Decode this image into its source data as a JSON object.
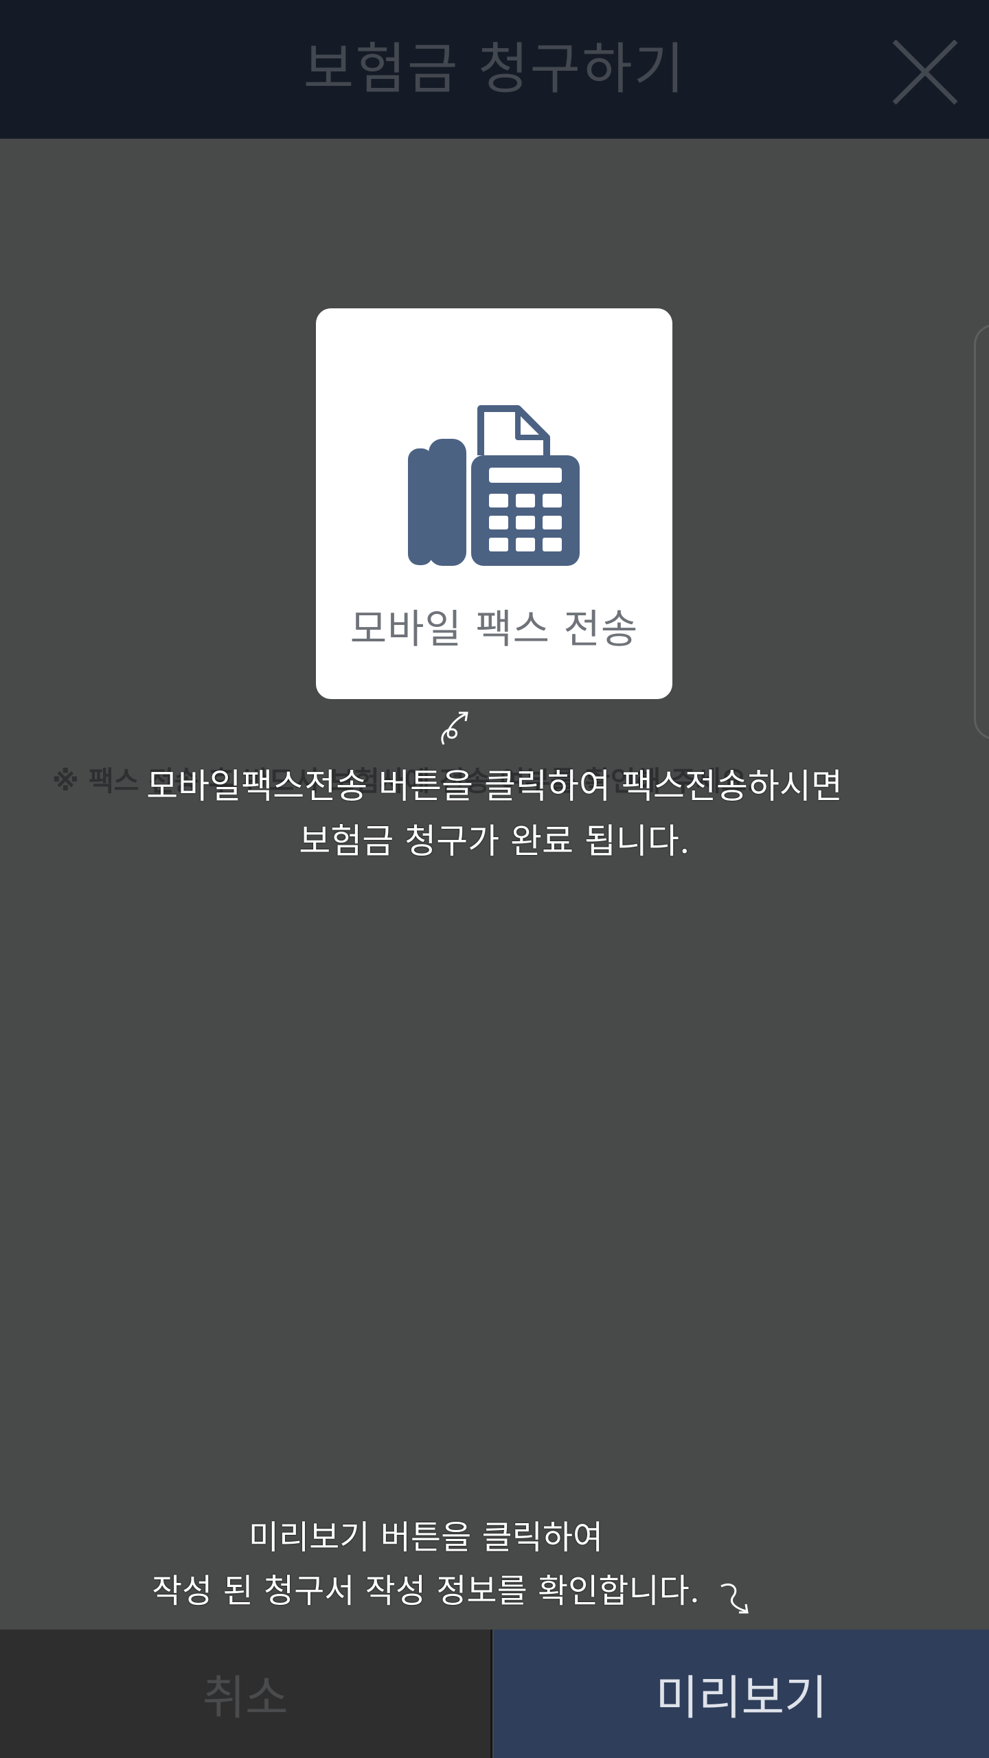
{
  "header": {
    "title": "보험금 청구하기",
    "close_icon": "close-icon"
  },
  "fax_card": {
    "label": "모바일 팩스 전송",
    "icon": "fax-icon"
  },
  "notice": {
    "text": "※ 팩스 전송 후 반드시 보험사에 전송 여부를 확인해 주세요."
  },
  "annotations": {
    "fax_line1": "모바일팩스전송 버튼을 클릭하여 팩스전송하시면",
    "fax_line2": "보험금 청구가 완료 됩니다.",
    "preview_line1": "미리보기 버튼을 클릭하여",
    "preview_line2": "작성 된 청구서 작성 정보를 확인합니다."
  },
  "bottom_bar": {
    "cancel_label": "취소",
    "preview_label": "미리보기"
  },
  "colors": {
    "header_bg": "#151b26",
    "dim_overlay": "#484949",
    "fax_icon": "#4c6283",
    "preview_bg": "#2f3e5a",
    "cancel_bg": "#2e2e2f"
  }
}
